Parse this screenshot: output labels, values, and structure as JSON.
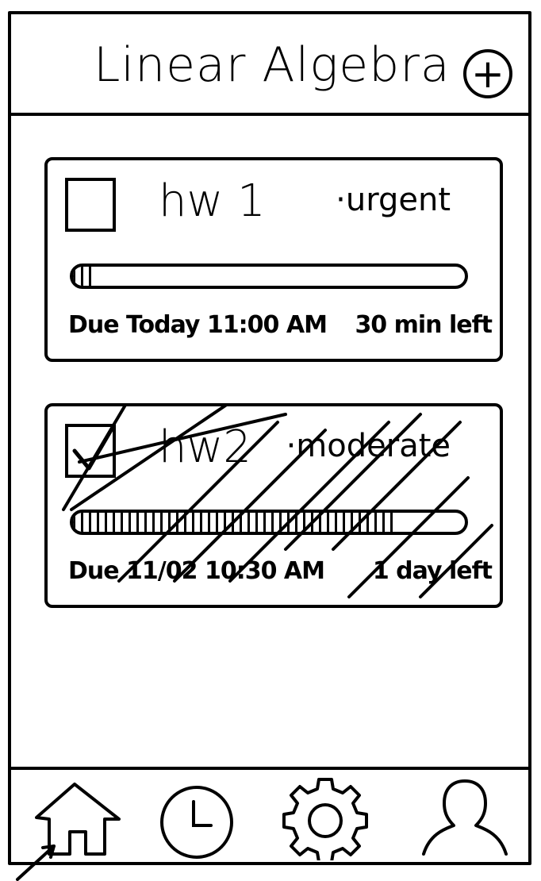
{
  "header": {
    "title": "Linear Algebra",
    "add_icon": "plus-circle-icon",
    "add_glyph": "+"
  },
  "tasks": [
    {
      "name": "hw 1",
      "priority": "·urgent",
      "completed": false,
      "progress": 0.05,
      "due": "Due Today 11:00 AM",
      "time_left": "30 min left"
    },
    {
      "name": "hw2",
      "priority": "·moderate",
      "completed": true,
      "progress": 0.82,
      "due": "Due 11/02 10:30 AM",
      "time_left": "1 day left"
    }
  ],
  "nav": {
    "items": [
      {
        "icon": "home-icon",
        "active": true
      },
      {
        "icon": "clock-icon",
        "active": false
      },
      {
        "icon": "gear-icon",
        "active": false
      },
      {
        "icon": "user-icon",
        "active": false
      }
    ]
  }
}
